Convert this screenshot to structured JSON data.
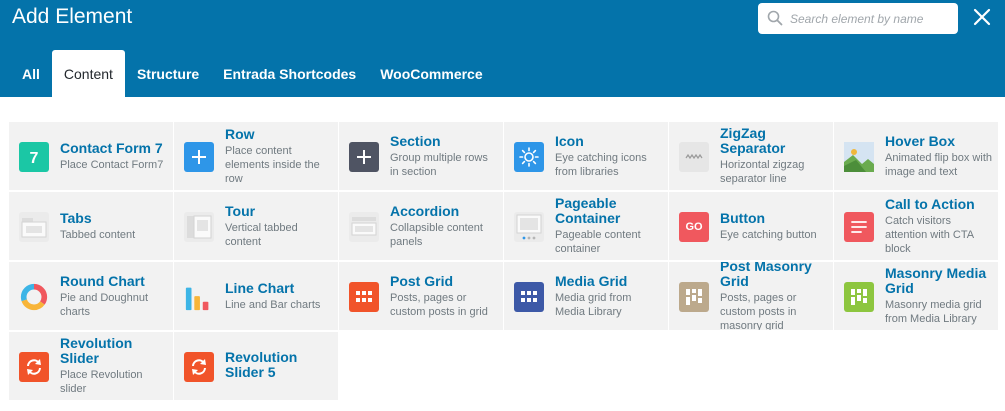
{
  "header": {
    "title": "Add Element",
    "search_placeholder": "Search element by name",
    "search_value": ""
  },
  "tabs": [
    {
      "label": "All",
      "active": false
    },
    {
      "label": "Content",
      "active": true
    },
    {
      "label": "Structure",
      "active": false
    },
    {
      "label": "Entrada Shortcodes",
      "active": false
    },
    {
      "label": "WooCommerce",
      "active": false
    }
  ],
  "colors": {
    "header_bg": "#0473aa",
    "title_text": "#0473aa",
    "tile_bg": "#f2f2f2",
    "description_text": "#707a80"
  },
  "elements": [
    {
      "title": "Contact Form 7",
      "description": "Place Contact Form7",
      "icon": "contact-form-7-icon"
    },
    {
      "title": "Row",
      "description": "Place content elements inside the row",
      "icon": "row-plus-icon"
    },
    {
      "title": "Section",
      "description": "Group multiple rows in section",
      "icon": "section-plus-icon"
    },
    {
      "title": "Icon",
      "description": "Eye catching icons from libraries",
      "icon": "sun-icon"
    },
    {
      "title": "ZigZag Separator",
      "description": "Horizontal zigzag separator line",
      "icon": "zigzag-icon"
    },
    {
      "title": "Hover Box",
      "description": "Animated flip box with image and text",
      "icon": "hover-box-image-icon"
    },
    {
      "title": "Tabs",
      "description": "Tabbed content",
      "icon": "tabs-icon"
    },
    {
      "title": "Tour",
      "description": "Vertical tabbed content",
      "icon": "tour-icon"
    },
    {
      "title": "Accordion",
      "description": "Collapsible content panels",
      "icon": "accordion-icon"
    },
    {
      "title": "Pageable Container",
      "description": "Pageable content container",
      "icon": "pageable-container-icon"
    },
    {
      "title": "Button",
      "description": "Eye catching button",
      "icon": "go-button-icon",
      "icon_text": "GO"
    },
    {
      "title": "Call to Action",
      "description": "Catch visitors attention with CTA block",
      "icon": "call-to-action-icon"
    },
    {
      "title": "Round Chart",
      "description": "Pie and Doughnut charts",
      "icon": "round-chart-icon"
    },
    {
      "title": "Line Chart",
      "description": "Line and Bar charts",
      "icon": "line-chart-icon"
    },
    {
      "title": "Post Grid",
      "description": "Posts, pages or custom posts in grid",
      "icon": "post-grid-icon"
    },
    {
      "title": "Media Grid",
      "description": "Media grid from Media Library",
      "icon": "media-grid-icon"
    },
    {
      "title": "Post Masonry Grid",
      "description": "Posts, pages or custom posts in masonry grid",
      "icon": "post-masonry-grid-icon"
    },
    {
      "title": "Masonry Media Grid",
      "description": "Masonry media grid from Media Library",
      "icon": "masonry-media-grid-icon"
    },
    {
      "title": "Revolution Slider",
      "description": "Place Revolution slider",
      "icon": "revolution-slider-icon"
    },
    {
      "title": "Revolution Slider 5",
      "description": "",
      "icon": "revolution-slider-5-icon"
    }
  ]
}
